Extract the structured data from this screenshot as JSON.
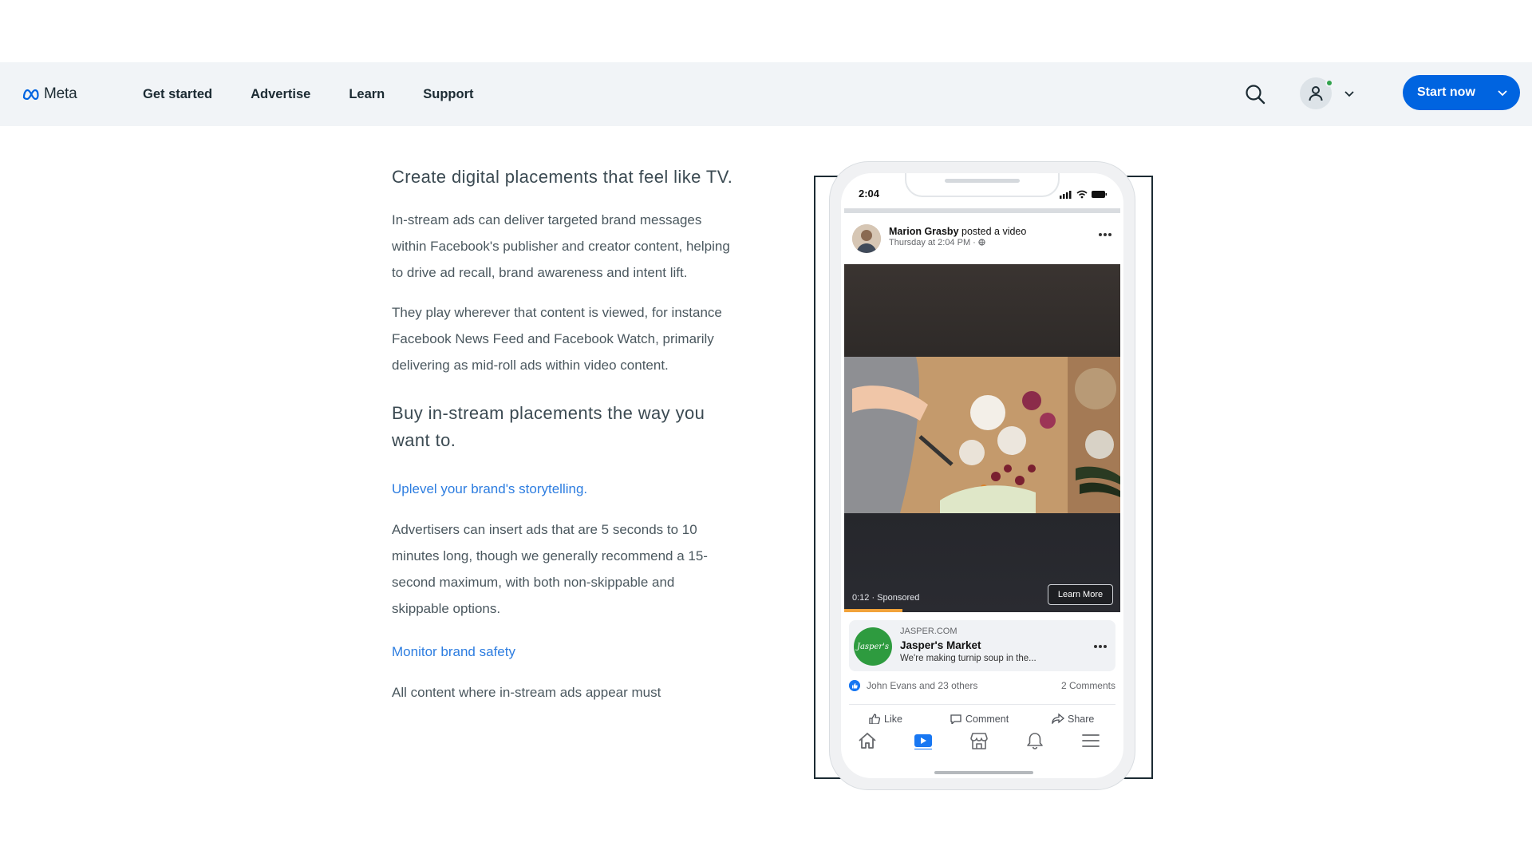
{
  "nav": {
    "logo_text": "Meta",
    "links": [
      {
        "label": "Get started"
      },
      {
        "label": "Advertise"
      },
      {
        "label": "Learn"
      },
      {
        "label": "Support"
      }
    ],
    "search_icon": "search-icon",
    "account_icon": "user-icon",
    "start_label": "Start now"
  },
  "content": {
    "heading1": "Create digital placements that feel like TV.",
    "para1": "In-stream ads can deliver targeted brand messages within Facebook's publisher and creator content, helping to drive ad recall, brand awareness and intent lift.",
    "para2": "They play wherever that content is viewed, for instance Facebook News Feed and Facebook Watch, primarily delivering as mid-roll ads within video content.",
    "heading2": "Buy in-stream placements the way you want to.",
    "sub1": "Uplevel your brand's storytelling.",
    "para3": "Advertisers can insert ads that are 5 seconds to 10 minutes long, though we generally recommend a 15-second maximum, with both non-skippable and skippable options.",
    "sub2": "Monitor brand safety",
    "para4": "All content where in-stream ads appear must"
  },
  "phone": {
    "time": "2:04",
    "post": {
      "author": "Marion Grasby",
      "action": "posted a video",
      "timestamp": "Thursday at 2:04 PM · "
    },
    "video": {
      "time_label": "0:12 · Sponsored",
      "cta": "Learn More",
      "progress": 0.21
    },
    "ad": {
      "domain": "JASPER.COM",
      "name": "Jasper's Market",
      "description": "We're making turnip soup in the...",
      "logo_text": "Jasper's"
    },
    "reactions": {
      "names": "John Evans and 23 others",
      "comments": "2 Comments"
    },
    "actions": [
      {
        "label": "Like",
        "icon": "thumbs-up-icon"
      },
      {
        "label": "Comment",
        "icon": "comment-icon"
      },
      {
        "label": "Share",
        "icon": "share-icon"
      }
    ],
    "tabs": [
      "home-icon",
      "watch-icon",
      "marketplace-icon",
      "bell-icon",
      "menu-icon"
    ]
  },
  "colors": {
    "brand_blue": "#0064e0",
    "link_blue": "#2d7de0",
    "nav_bg": "#f1f4f7"
  }
}
